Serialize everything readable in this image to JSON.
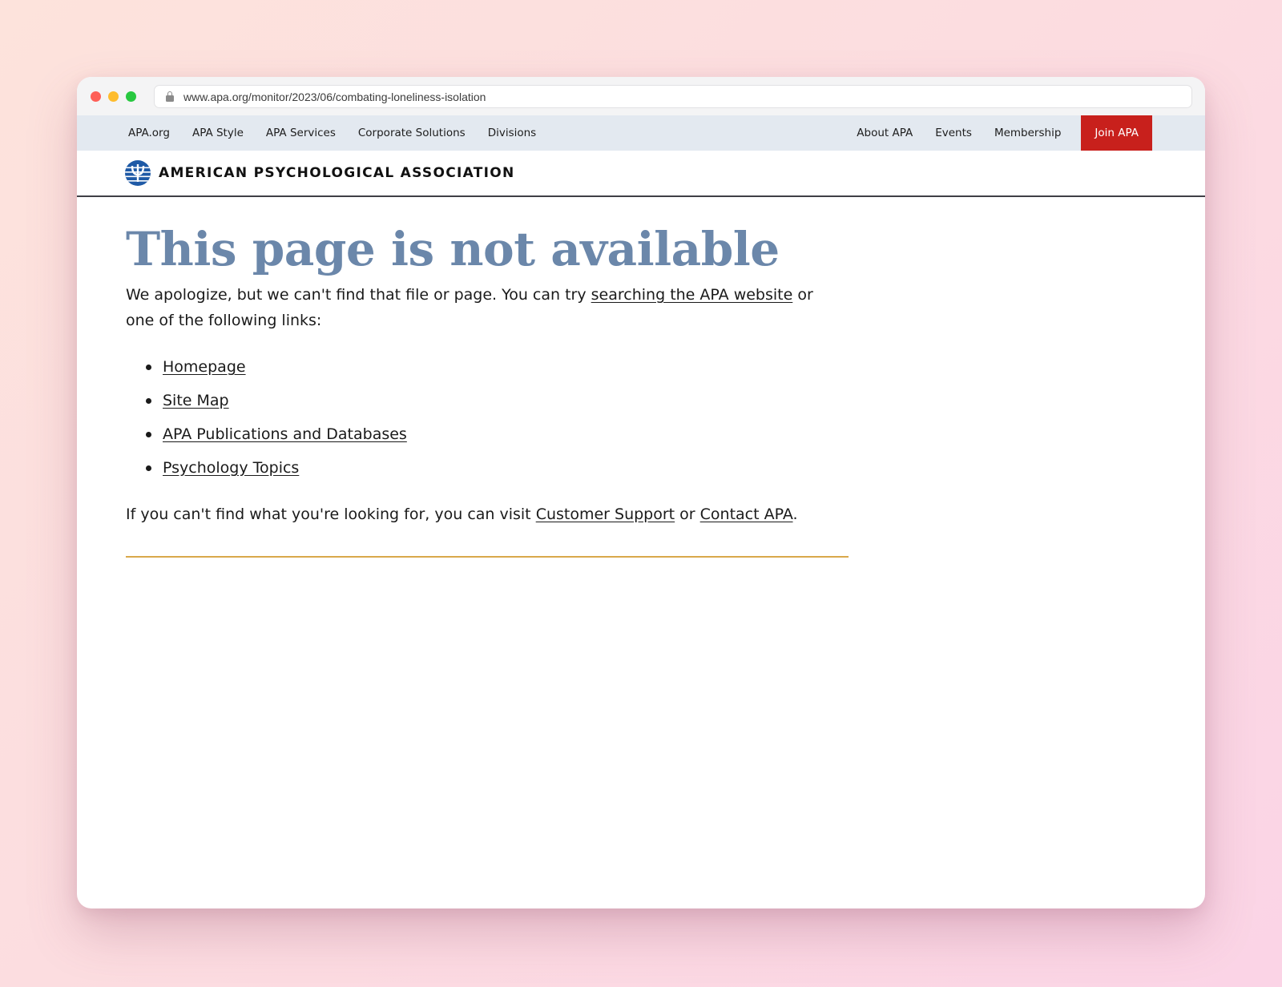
{
  "browser": {
    "url": "www.apa.org/monitor/2023/06/combating-loneliness-isolation"
  },
  "topnav": {
    "left": [
      "APA.org",
      "APA Style",
      "APA Services",
      "Corporate Solutions",
      "Divisions"
    ],
    "right": [
      "About APA",
      "Events",
      "Membership"
    ],
    "join_label": "Join APA",
    "join_color": "#c8201c"
  },
  "brand": {
    "name": "AMERICAN PSYCHOLOGICAL ASSOCIATION"
  },
  "main": {
    "title": "This page is not available",
    "intro_before": "We apologize, but we can't find that file or page. You can try ",
    "intro_link": "searching the APA website",
    "intro_after": " or one of the following links:",
    "links": [
      "Homepage",
      "Site Map",
      "APA Publications and Databases",
      "Psychology Topics"
    ],
    "support_before": "If you can't find what you're looking for, you can visit ",
    "support_link1": "Customer Support",
    "support_mid": " or ",
    "support_link2": "Contact APA",
    "support_after": "."
  },
  "colors": {
    "title": "#6b87aa",
    "nav_bg": "#e3e9f0",
    "rule": "#d9a84a"
  }
}
